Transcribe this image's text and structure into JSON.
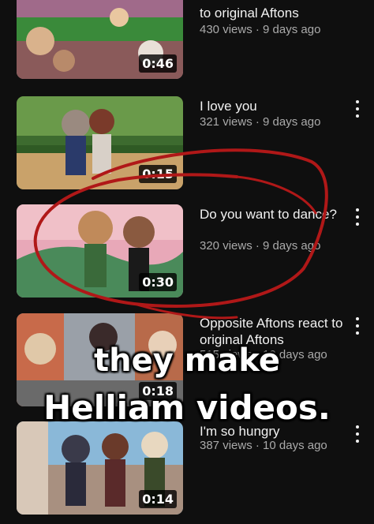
{
  "videos": [
    {
      "title": "to original Aftons",
      "meta": "430 views · 9 days ago",
      "duration": "0:46"
    },
    {
      "title": "I love you",
      "meta": "321 views · 9 days ago",
      "duration": "0:15"
    },
    {
      "title": "Do you want to dance?",
      "meta": "320 views · 9 days ago",
      "duration": "0:30"
    },
    {
      "title": "Opposite Aftons react to original Aftons",
      "meta": "515 views · 10 days ago",
      "duration": "0:18"
    },
    {
      "title": "I'm so hungry",
      "meta": "387 views · 10 days ago",
      "duration": "0:14"
    }
  ],
  "overlay": {
    "line1": "they make",
    "line2": "Helliam videos."
  },
  "colors": {
    "background": "#0f0f0f",
    "scribble": "#b01818",
    "meta_text": "#aaaaaa"
  },
  "icons": [
    "more-vert-icon"
  ]
}
